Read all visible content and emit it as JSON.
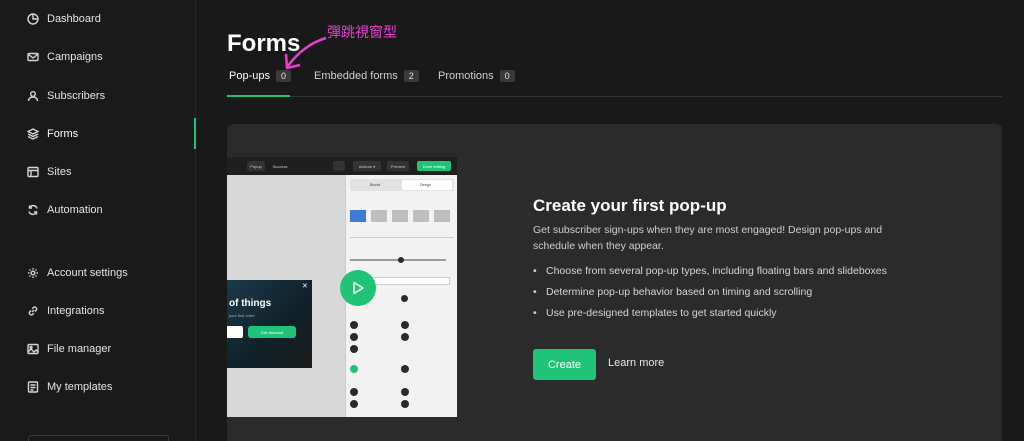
{
  "sidebar": {
    "items": [
      {
        "label": "Dashboard",
        "icon": "dashboard-icon"
      },
      {
        "label": "Campaigns",
        "icon": "mail-icon"
      },
      {
        "label": "Subscribers",
        "icon": "user-icon"
      },
      {
        "label": "Forms",
        "icon": "layers-icon",
        "active": true
      },
      {
        "label": "Sites",
        "icon": "sites-icon"
      },
      {
        "label": "Automation",
        "icon": "refresh-icon"
      },
      {
        "label": "Account settings",
        "icon": "gear-icon"
      },
      {
        "label": "Integrations",
        "icon": "link-icon"
      },
      {
        "label": "File manager",
        "icon": "image-icon"
      },
      {
        "label": "My templates",
        "icon": "template-icon"
      }
    ]
  },
  "header": {
    "title": "Forms",
    "annotation": "彈跳視窗型"
  },
  "tabs": [
    {
      "label": "Pop-ups",
      "count": "0",
      "active": true
    },
    {
      "label": "Embedded forms",
      "count": "2"
    },
    {
      "label": "Promotions",
      "count": "0"
    }
  ],
  "preview": {
    "topbar": {
      "popup": "Popup",
      "success": "Success",
      "actions": "Actions ▾",
      "preview": "Preview",
      "done": "Done editing"
    },
    "panel_tabs": {
      "blocks": "Blocks",
      "design": "Design"
    },
    "popup_title": "of things",
    "popup_sub": "your first order",
    "popup_button": "Get discount"
  },
  "cta": {
    "title": "Create your first pop-up",
    "description": "Get subscriber sign-ups when they are most engaged! Design pop-ups and schedule when they appear.",
    "bullets": [
      "Choose from several pop-up types, including floating bars and slideboxes",
      "Determine pop-up behavior based on timing and scrolling",
      "Use pre-designed templates to get started quickly"
    ],
    "create_label": "Create",
    "learn_label": "Learn more"
  },
  "colors": {
    "accent": "#1fc478",
    "annotation": "#e83fd2",
    "background": "#191919",
    "card": "#2b2b2b"
  }
}
